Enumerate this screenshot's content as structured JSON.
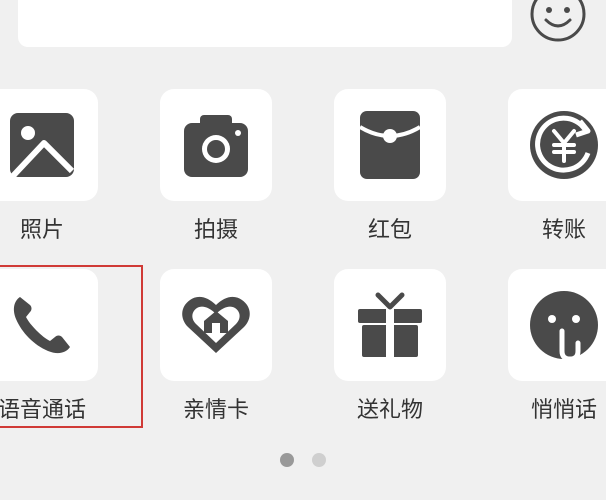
{
  "panel": {
    "items": [
      {
        "label": "照片",
        "icon": "photo-icon"
      },
      {
        "label": "拍摄",
        "icon": "camera-icon"
      },
      {
        "label": "红包",
        "icon": "red-packet-icon"
      },
      {
        "label": "转账",
        "icon": "transfer-icon"
      },
      {
        "label": "语音通话",
        "icon": "phone-icon"
      },
      {
        "label": "亲情卡",
        "icon": "family-card-icon"
      },
      {
        "label": "送礼物",
        "icon": "gift-icon"
      },
      {
        "label": "悄悄话",
        "icon": "whisper-icon"
      }
    ],
    "selected_index": 4
  },
  "pager": {
    "pages": 2,
    "current": 1
  },
  "colors": {
    "background": "#f0f0f0",
    "tile": "#ffffff",
    "icon": "#4a4a4a",
    "label": "#333333",
    "highlight_border": "#d03a36",
    "dot_active": "#999999",
    "dot_inactive": "#cfcfcf"
  }
}
